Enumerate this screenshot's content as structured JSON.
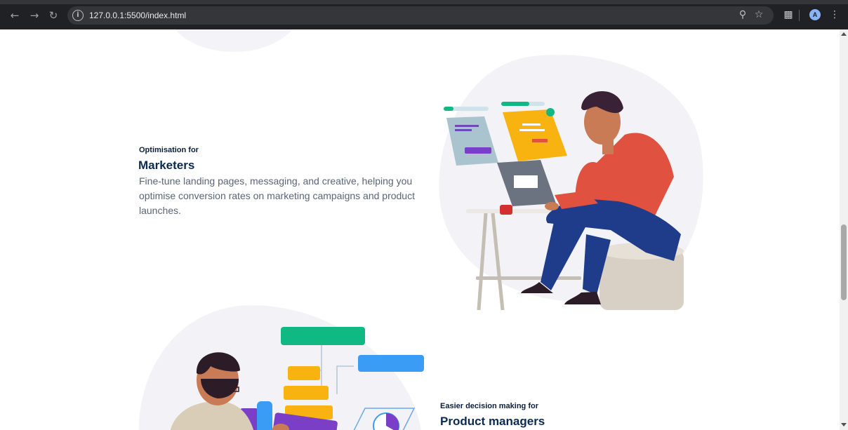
{
  "browser": {
    "url": "127.0.0.1:5500/index.html",
    "profile_initial": "A"
  },
  "sections": [
    {
      "eyebrow": "Optimisation for",
      "title": "Marketers",
      "description": "Fine-tune landing pages, messaging, and creative, helping you optimise conversion rates on marketing campaigns and product launches."
    },
    {
      "eyebrow": "Easier decision making for",
      "title": "Product managers"
    }
  ],
  "colors": {
    "heading": "#0b2a52",
    "body_text": "#5a6577",
    "blob": "#f3f3f7",
    "green": "#10b981",
    "blue": "#3b9cf5",
    "yellow": "#f9b310",
    "purple": "#7b3fc7",
    "red_shirt": "#e0513f",
    "jeans": "#1f3c8a"
  },
  "icons": [
    "back-arrow-icon",
    "forward-arrow-icon",
    "reload-icon",
    "info-icon",
    "zoom-icon",
    "star-icon",
    "extensions-icon",
    "kebab-menu-icon"
  ]
}
